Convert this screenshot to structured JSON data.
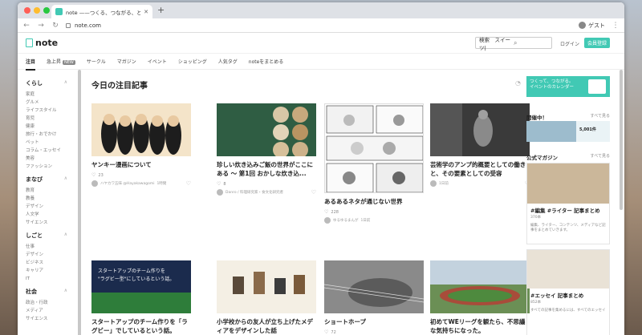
{
  "browser": {
    "tab_title": "note ——つくる、つながる、とど",
    "url": "note.com",
    "profile": "ゲスト"
  },
  "header": {
    "logo": "note",
    "search_value": "検索　スイーツ|",
    "login": "ログイン",
    "signup": "会員登録"
  },
  "subnav": [
    "注目",
    "急上昇",
    "サークル",
    "マガジン",
    "イベント",
    "ショッピング",
    "人気タグ",
    "noteをまとめる"
  ],
  "subnav_badge": "NEW",
  "sidebar": [
    {
      "title": "くらし",
      "items": [
        "家庭",
        "グルメ",
        "ライフスタイル",
        "育児",
        "健康",
        "旅行・おでかけ",
        "ペット",
        "コラム・エッセイ",
        "美容",
        "ファッション"
      ]
    },
    {
      "title": "まなび",
      "items": [
        "教育",
        "教養",
        "デザイン",
        "人文学",
        "サイエンス"
      ]
    },
    {
      "title": "しごと",
      "items": [
        "仕事",
        "デザイン",
        "ビジネス",
        "キャリア",
        "IT"
      ]
    },
    {
      "title": "社会",
      "items": [
        "政治・行政",
        "メディア",
        "サイエンス"
      ]
    }
  ],
  "main": {
    "title": "今日の注目記事",
    "cards": [
      {
        "title": "ヤンキー漫画について",
        "likes": "23",
        "author": "ハヤカワ五味 @Hayakawagomi",
        "date": "1時間"
      },
      {
        "title": "珍しい炊き込みご飯の世界がここにある 〜 第1回 おかしな炊き込...",
        "likes": "8",
        "author": "Danro / 料理研究家・食文化研究者",
        "date": "1時間",
        "img_text": "第１回\nおかしな\n炊き込みご飯\n選手権"
      },
      {
        "title": "あるあるネタが通じない世界",
        "likes": "228",
        "author": "ゆるゆるまんが",
        "date": "1日前"
      },
      {
        "title": "芸術学のアンプ的概要としての働きと、その要素としての受容",
        "likes": "",
        "author": "",
        "date": "1日前"
      },
      {
        "title": "スタートアップのチーム作りを「ラグビー」でしているという話。",
        "likes": "",
        "img_text": "スタートアップのチーム作りを\n\"ラグビー型\"にしているという話。"
      },
      {
        "title": "小学校からの友人が立ち上げたメディアをデザインした話",
        "likes": ""
      },
      {
        "title": "ショートホープ",
        "likes": "72"
      },
      {
        "title": "初めてWEリーグを観たら、不思議な気持ちになった。",
        "likes": ""
      }
    ]
  },
  "right": {
    "banner": "つくって、つながる。\nイベントのカレンダー",
    "section1": "開催中！",
    "section1_more": "すべて見る",
    "event_count": "5,001件",
    "section2": "公式マガジン",
    "section2_more": "すべて見る",
    "mag1_title": "#編集 #ライター 記事まとめ",
    "mag1_count": "370本",
    "mag1_desc": "編集、ライター、コンテンツ、メディアなど記事をまとめていきます。",
    "mag2_title": "#エッセイ 記事まとめ",
    "mag2_count": "852本",
    "mag2_desc": "すべての記事を集めるには、すべてのエッセイ"
  }
}
